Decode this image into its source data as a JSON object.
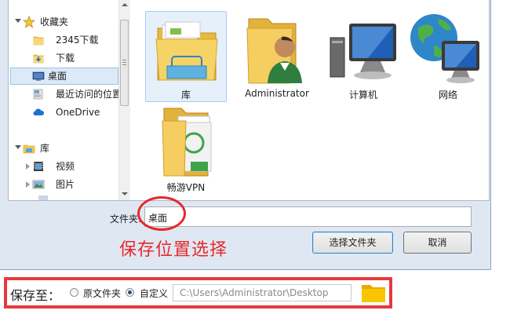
{
  "nav": {
    "favorites": "收藏夹",
    "item_2345": "2345下载",
    "downloads": "下载",
    "desktop": "桌面",
    "recent": "最近访问的位置",
    "onedrive": "OneDrive",
    "libraries": "库",
    "videos": "视频",
    "pictures": "图片"
  },
  "files": [
    {
      "label": "库",
      "icon": "library-folder-icon"
    },
    {
      "label": "Administrator",
      "icon": "user-folder-icon"
    },
    {
      "label": "计算机",
      "icon": "computer-icon"
    },
    {
      "label": "网络",
      "icon": "network-globe-icon"
    },
    {
      "label": "畅游VPN",
      "icon": "vpn-folder-icon"
    }
  ],
  "filename": {
    "label": "文件夹:",
    "value": "桌面"
  },
  "annotation": "保存位置选择",
  "buttons": {
    "select_folder": "选择文件夹",
    "cancel": "取消"
  },
  "save_to": {
    "label": "保存至：",
    "option_original": "原文件夹",
    "option_custom": "自定义",
    "selected": "custom",
    "path": "C:\\Users\\Administrator\\Desktop"
  },
  "colors": {
    "annotation_red": "#e8282c",
    "folder_yellow": "#f5c518",
    "selection_blue": "#dce9f7"
  }
}
